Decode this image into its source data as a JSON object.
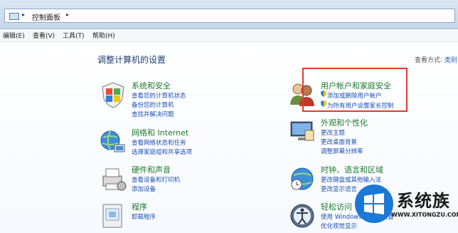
{
  "address_bar": {
    "breadcrumb": "控制面板"
  },
  "menu": [
    "编辑(E)",
    "查看(V)",
    "工具(T)",
    "帮助(H)"
  ],
  "page_title": "调整计算机的设置",
  "view_by": {
    "label": "查看方式:",
    "value": "类别"
  },
  "categories_left": [
    {
      "title": "系统和安全",
      "icon": "shield-flag-icon",
      "links": [
        "查看您的计算机状态",
        "备份您的计算机",
        "查找并解决问题"
      ]
    },
    {
      "title": "网络和 Internet",
      "icon": "network-globe-icon",
      "links": [
        "查看网络状态和任务",
        "选择家庭组和共享选项"
      ]
    },
    {
      "title": "硬件和声音",
      "icon": "printer-icon",
      "links": [
        "查看设备和打印机",
        "添加设备"
      ]
    },
    {
      "title": "程序",
      "icon": "programs-icon",
      "links": [
        "卸载程序"
      ]
    }
  ],
  "categories_right": [
    {
      "title": "用户帐户和家庭安全",
      "icon": "users-icon",
      "links": [
        "添加或删除用户帐户",
        "为所有用户设置家长控制"
      ]
    },
    {
      "title": "外观和个性化",
      "icon": "display-icon",
      "links": [
        "更改主题",
        "更改桌面背景",
        "调整屏幕分辨率"
      ]
    },
    {
      "title": "时钟、语言和区域",
      "icon": "clock-globe-icon",
      "links": [
        "更改键盘或其他输入法",
        "更改显示语言"
      ]
    },
    {
      "title": "轻松访问",
      "icon": "ease-of-access-icon",
      "links": [
        "使用 Windows 建议的设置",
        "优化视觉显示"
      ]
    }
  ],
  "watermark": {
    "text": "系统族",
    "url": "WWW.XITONGZU.COM"
  },
  "colors": {
    "highlight": "#e23a2e",
    "category_title": "#1e7a2e",
    "link": "#1d4fb0"
  }
}
